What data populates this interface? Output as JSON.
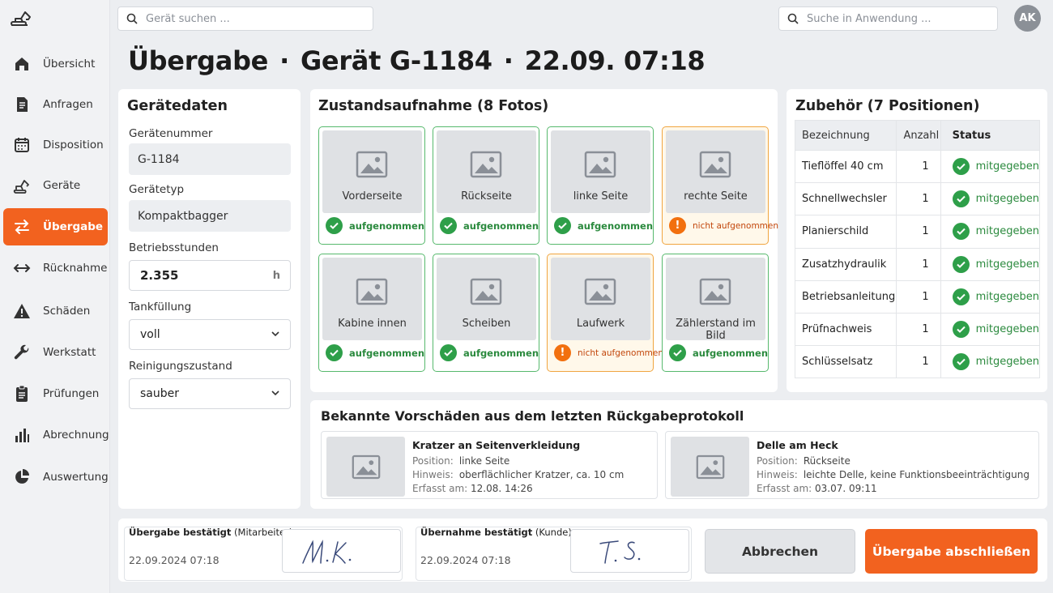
{
  "header": {
    "device_search_placeholder": "Gerät suchen ...",
    "app_search_placeholder": "Suche in Anwendung ...",
    "avatar_initials": "AK"
  },
  "sidebar": {
    "items": [
      {
        "label": "Übersicht",
        "icon": "home-icon"
      },
      {
        "label": "Anfragen",
        "icon": "document-icon"
      },
      {
        "label": "Disposition",
        "icon": "calendar-icon"
      },
      {
        "label": "Geräte",
        "icon": "excavator-icon"
      },
      {
        "label": "Übergabe",
        "icon": "swap-icon",
        "active": true
      },
      {
        "label": "Rücknahme",
        "icon": "return-arrows-icon"
      },
      {
        "label": "Schäden",
        "icon": "warning-icon"
      },
      {
        "label": "Werkstatt",
        "icon": "wrench-icon"
      },
      {
        "label": "Prüfungen",
        "icon": "clipboard-icon"
      },
      {
        "label": "Abrechnung",
        "icon": "bar-chart-icon"
      },
      {
        "label": "Auswertung",
        "icon": "pie-chart-icon"
      }
    ]
  },
  "page": {
    "title_part1": "Übergabe",
    "title_part2": "Gerät G-1184",
    "title_part3": "22.09. 07:18",
    "separator": "·"
  },
  "device_data": {
    "title": "Gerätedaten",
    "number_label": "Gerätenummer",
    "number_value": "G-1184",
    "type_label": "Gerätetyp",
    "type_value": "Kompaktbagger",
    "hours_label": "Betriebsstunden",
    "hours_value": "2.355",
    "hours_unit": "h",
    "tank_label": "Tankfüllung",
    "tank_value": "voll",
    "clean_label": "Reinigungszustand",
    "clean_value": "sauber"
  },
  "photos": {
    "title": "Zustandsaufnahme (8 Fotos)",
    "items": [
      {
        "label": "Vorderseite",
        "status": "aufgenommen",
        "ok": true
      },
      {
        "label": "Rückseite",
        "status": "aufgenommen",
        "ok": true
      },
      {
        "label": "linke Seite",
        "status": "aufgenommen",
        "ok": true
      },
      {
        "label": "rechte Seite",
        "status": "nicht aufgenommen",
        "ok": false
      },
      {
        "label": "Kabine innen",
        "status": "aufgenommen",
        "ok": true
      },
      {
        "label": "Scheiben",
        "status": "aufgenommen",
        "ok": true
      },
      {
        "label": "Laufwerk",
        "status": "nicht aufgenommen",
        "ok": false
      },
      {
        "label": "Zählerstand im Bild",
        "status": "aufgenommen",
        "ok": true
      }
    ]
  },
  "accessories": {
    "title": "Zubehör (7 Positionen)",
    "columns": [
      "Bezeichnung",
      "Anzahl",
      "Status"
    ],
    "rows": [
      {
        "name": "Tieflöffel 40 cm",
        "qty": "1",
        "status": "mitgegeben"
      },
      {
        "name": "Schnellwechsler",
        "qty": "1",
        "status": "mitgegeben"
      },
      {
        "name": "Planierschild",
        "qty": "1",
        "status": "mitgegeben"
      },
      {
        "name": "Zusatzhydraulik",
        "qty": "1",
        "status": "mitgegeben"
      },
      {
        "name": "Betriebsanleitung",
        "qty": "1",
        "status": "mitgegeben"
      },
      {
        "name": "Prüfnachweis",
        "qty": "1",
        "status": "mitgegeben"
      },
      {
        "name": "Schlüsselsatz",
        "qty": "1",
        "status": "mitgegeben"
      }
    ]
  },
  "damages": {
    "title": "Bekannte Vorschäden aus dem letzten Rückgabeprotokoll",
    "position_key": "Position:",
    "note_key": "Hinweis:",
    "recorded_key": "Erfasst am:",
    "items": [
      {
        "title": "Kratzer an Seitenverkleidung",
        "position": "linke Seite",
        "note": "oberflächlicher Kratzer, ca. 10 cm",
        "recorded": "12.08. 14:26"
      },
      {
        "title": "Delle am Heck",
        "position": "Rückseite",
        "note": "leichte Delle, keine Funktionsbeeinträchtigung",
        "recorded": "03.07. 09:11"
      }
    ]
  },
  "footer": {
    "staff_label_bold": "Übergabe bestätigt",
    "staff_label_rest": " (Mitarbeiter)",
    "staff_date": "22.09.2024 07:18",
    "staff_signature": "M.K.",
    "customer_label_bold": "Übernahme bestätigt",
    "customer_label_rest": " (Kunde)",
    "customer_date": "22.09.2024 07:18",
    "customer_signature": "T.S.",
    "cancel_label": "Abbrechen",
    "submit_label": "Übergabe abschließen"
  },
  "colors": {
    "accent": "#f2621f",
    "ok": "#2e9f49",
    "warn": "#f2700f"
  }
}
